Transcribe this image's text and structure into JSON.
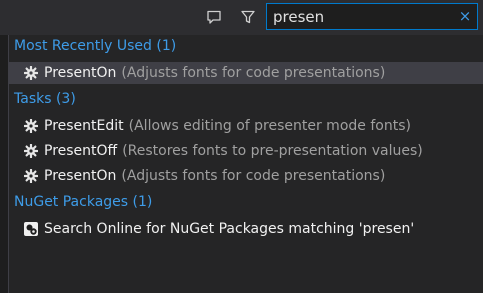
{
  "search": {
    "value": "presen",
    "clear_glyph": "×",
    "placeholder": ""
  },
  "toolbar": {
    "icons": [
      "feedback-icon",
      "filter-icon"
    ]
  },
  "sections": {
    "mru": {
      "header": "Most Recently Used (1)",
      "items": [
        {
          "name": "PresentOn",
          "desc": "(Adjusts fonts for code presentations)",
          "icon": "gear-icon",
          "selected": true
        }
      ]
    },
    "tasks": {
      "header": "Tasks (3)",
      "items": [
        {
          "name": "PresentEdit",
          "desc": "(Allows editing of presenter mode fonts)",
          "icon": "gear-icon"
        },
        {
          "name": "PresentOff",
          "desc": "(Restores fonts to pre-presentation values)",
          "icon": "gear-icon"
        },
        {
          "name": "PresentOn",
          "desc": "(Adjusts fonts for code presentations)",
          "icon": "gear-icon"
        }
      ]
    },
    "nuget": {
      "header": "NuGet Packages (1)",
      "items": [
        {
          "name": "Search Online for NuGet Packages matching 'presen'",
          "desc": "",
          "icon": "nuget-search-icon"
        }
      ]
    }
  },
  "colors": {
    "accent": "#007acc",
    "header_text": "#3e9ce8",
    "selected_row": "#3f3f46",
    "popup_bg": "#252526"
  }
}
